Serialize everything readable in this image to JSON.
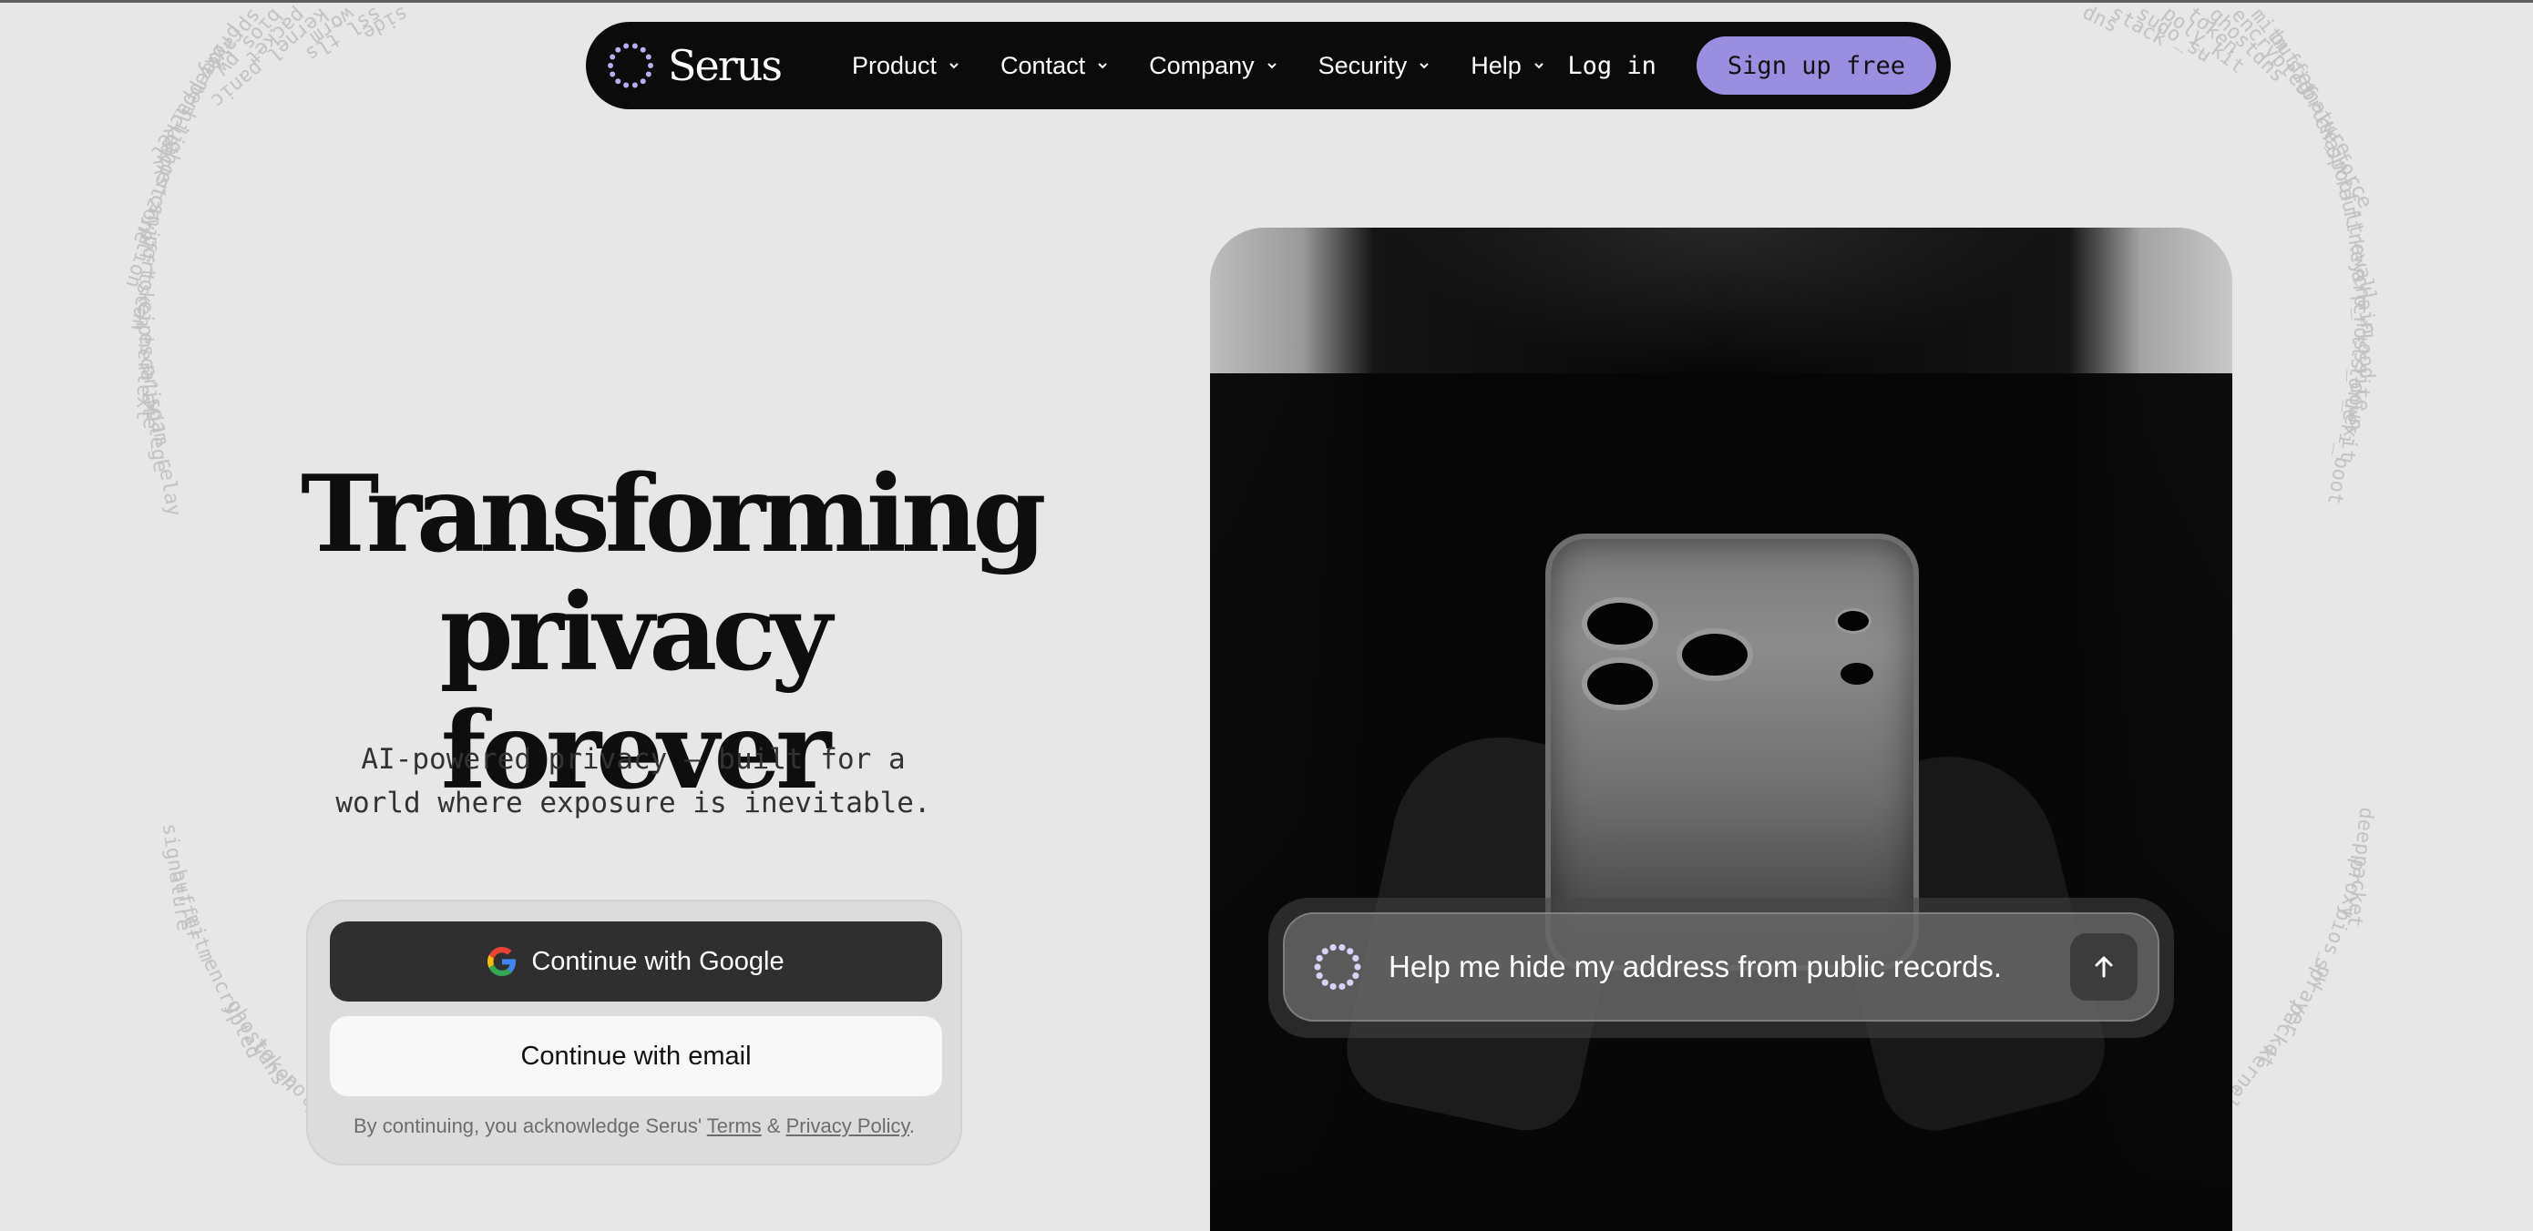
{
  "nav": {
    "brand": "Serus",
    "links": [
      {
        "label": "Product"
      },
      {
        "label": "Contact"
      },
      {
        "label": "Company"
      },
      {
        "label": "Security"
      },
      {
        "label": "Help"
      }
    ],
    "login_label": "Log in",
    "signup_label": "Sign up free"
  },
  "hero": {
    "title": "Transforming\nprivacy forever",
    "subtitle": "AI-powered privacy — built for a\nworld where exposure is inevitable."
  },
  "auth": {
    "google_label": "Continue with Google",
    "email_label": "Continue with email",
    "legal_prefix": "By continuing, you acknowledge Serus'",
    "terms_label": "Terms",
    "amp": "&",
    "privacy_label": "Privacy Policy",
    "legal_suffix": "."
  },
  "chat": {
    "prompt": "Help me hide my address from public records."
  },
  "decor_words": [
    "side",
    "ssl_tls",
    "worm",
    "kernel_panic",
    "packet",
    "bios_pw",
    "sprayer",
    "proxy",
    "deeppacket",
    "mem_leak",
    "hijack",
    "ghostzone",
    "encryption",
    "sniff",
    "portscan",
    "token",
    "ciphertext",
    "escalate",
    "privilege",
    "spam_relay",
    "dns",
    "stack",
    "sudo_su",
    "poly_kit",
    "token",
    "ghostdns",
    "encrypted",
    "mitm",
    "buffer",
    "signature",
    "brute_force",
    "chain",
    "spoof",
    "fault",
    "firewall",
    "keychain",
    "arp_flood",
    "crosssite",
    "tls_down",
    "tor_exit",
    "uefi_boot",
    "signature",
    "buffer",
    "mitm",
    "encrypted",
    "ghostdns",
    "token",
    "poly_kit",
    "sudo",
    "deeppacket",
    "proxy",
    "bios_pw",
    "sprayer",
    "packet",
    "kernel_panic",
    "worm"
  ],
  "colors": {
    "background": "#e7e7e7",
    "nav_bg": "#0b0b0b",
    "signup_bg": "#9a8ee0",
    "google_btn_bg": "#2f2f2f",
    "email_btn_bg": "#f8f8f8",
    "logo_dots": "#b8aef0"
  },
  "icons": {
    "logo": "dotted-circle-logo",
    "google": "google-g-icon",
    "chevron": "chevron-down-icon",
    "send": "arrow-up-icon",
    "assistant": "dotted-circle-icon"
  }
}
